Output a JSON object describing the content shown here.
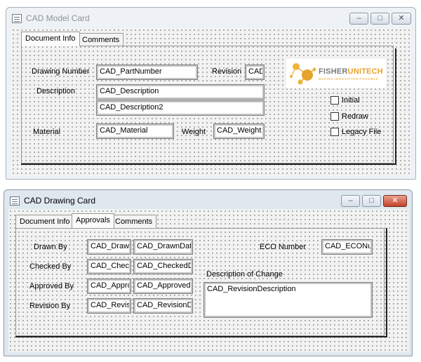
{
  "model_card": {
    "title": "CAD Model Card",
    "controls": {
      "minimize": "–",
      "maximize": "□",
      "close": "✕"
    },
    "tabs": [
      "Document Info",
      "Comments"
    ],
    "labels": {
      "drawing_number": "Drawing Number",
      "revision": "Revision",
      "description": "Description",
      "material": "Material",
      "weight": "Weight"
    },
    "fields": {
      "part_number": "CAD_PartNumber",
      "revision": "CAD",
      "description": "CAD_Description",
      "description2": "CAD_Description2",
      "material": "CAD_Material",
      "weight": "CAD_Weight"
    },
    "logo": {
      "word1": "FISHER",
      "word2": "UNITECH",
      "tagline": "MAKING INNOVATION POSSIBLE",
      "icon": "molecule-logo-icon"
    },
    "checkboxes": [
      {
        "label": "Initial",
        "checked": false
      },
      {
        "label": "Redraw",
        "checked": false
      },
      {
        "label": "Legacy File",
        "checked": false
      }
    ]
  },
  "drawing_card": {
    "title": "CAD Drawing Card",
    "controls": {
      "minimize": "–",
      "maximize": "□",
      "close": "✕"
    },
    "tabs": [
      "Document Info",
      "Approvals",
      "Comments"
    ],
    "active_tab": "Approvals",
    "rows": [
      {
        "label": "Drawn By",
        "name": "CAD_Drawn",
        "date": "CAD_DrawnDate"
      },
      {
        "label": "Checked By",
        "name": "CAD_Check",
        "date": "CAD_CheckedDa"
      },
      {
        "label": "Approved By",
        "name": "CAD_Appro",
        "date": "CAD_ApprovedD"
      },
      {
        "label": "Revision By",
        "name": "CAD_Revisi",
        "date": "CAD_RevisionDa"
      }
    ],
    "eco_label": "ECO Number",
    "eco_value": "CAD_ECONum",
    "change_label": "Description of Change",
    "change_value": "CAD_RevisionDescription"
  },
  "colors": {
    "accent": "#e5a42b",
    "close_button": "#c2412a"
  }
}
